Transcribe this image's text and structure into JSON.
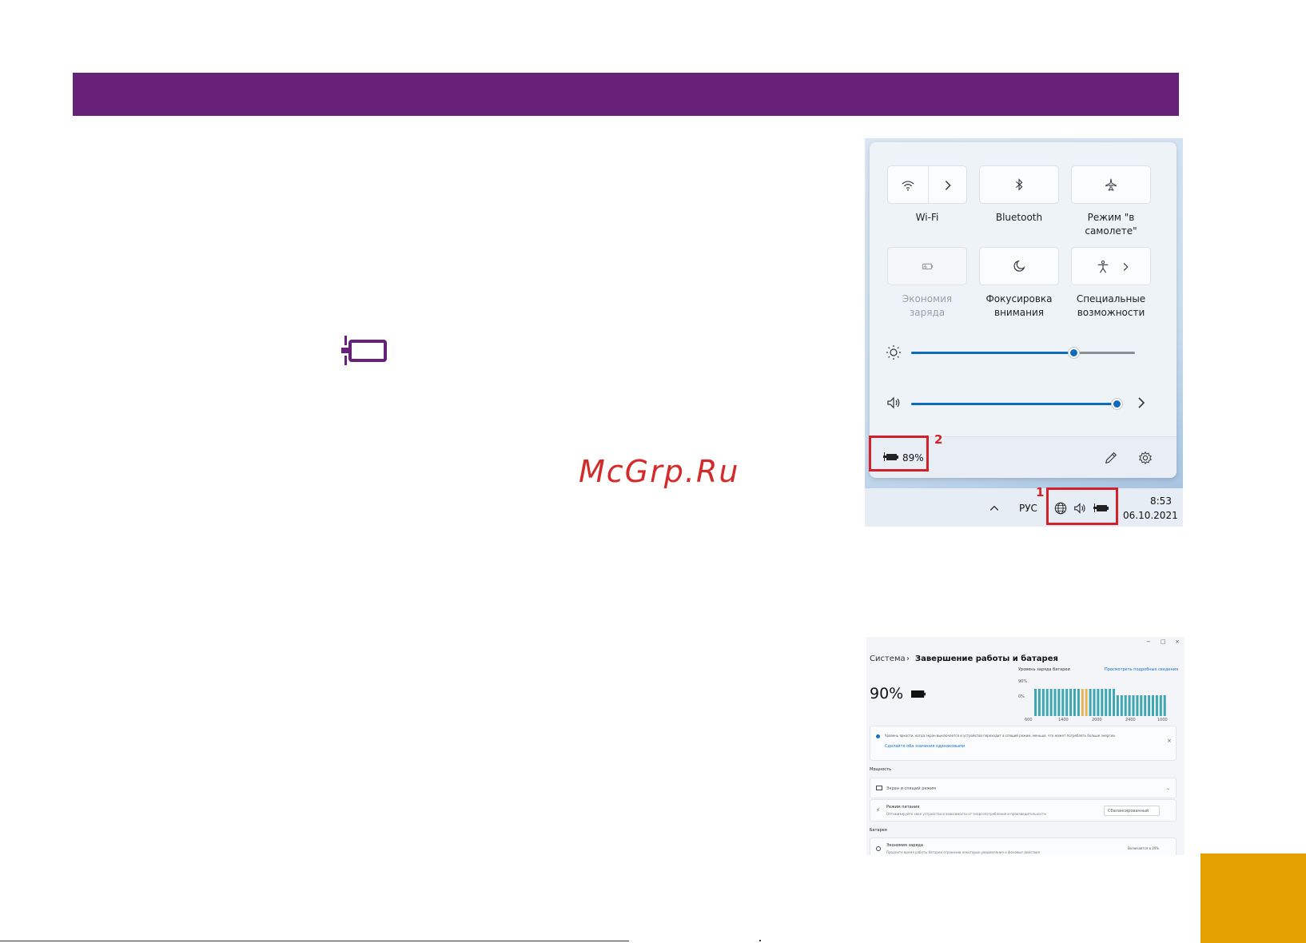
{
  "watermark": "McGrp.Ru",
  "quick_settings": {
    "tiles": [
      {
        "label": "Wi-Fi",
        "icon": "wifi-icon"
      },
      {
        "label": "Bluetooth",
        "icon": "bluetooth-icon"
      },
      {
        "label": "Режим \"в самолете\"",
        "icon": "airplane-icon"
      },
      {
        "label": "Экономия заряда",
        "icon": "battery-saver-icon"
      },
      {
        "label": "Фокусировка внимания",
        "icon": "moon-icon"
      },
      {
        "label": "Специальные возможности",
        "icon": "accessibility-icon"
      }
    ],
    "brightness_level": 0.73,
    "volume_level": 1.0,
    "battery_percent": "89%",
    "callout_1": "1",
    "callout_2": "2",
    "taskbar": {
      "language": "РУС",
      "time": "8:53",
      "date": "06.10.2021"
    }
  },
  "settings_window": {
    "breadcrumb_root": "Система",
    "breadcrumb_page": "Завершение работы и батарея",
    "battery_percent": "90%",
    "chart_title": "Уровень заряда батареи",
    "chart_link": "Просмотреть подробные сведения",
    "y_ticks": [
      "90%",
      "0%"
    ],
    "x_ticks": [
      "600",
      "1400",
      "2000",
      "2400",
      "1000"
    ],
    "info_text": "Уровень яркости, когда экран выключается и устройство переходит в спящий режим, меньше, что может потреблять больше энергии.",
    "info_link": "Сделайте оба значения одинаковыми",
    "section_power": "Мощность",
    "row_screen_sleep": "Экран и спящий режим",
    "row_power_mode": "Режим питания",
    "row_power_mode_desc": "Оптимизируйте свое устройство в зависимости от энергопотребления и производительности",
    "power_mode_value": "Сбалансированный",
    "section_battery": "Батарея",
    "row_battery_saver": "Экономия заряда",
    "row_battery_saver_desc": "Продлите время работы батареи ограничив некоторые уведомления и фоновые действия",
    "battery_saver_value": "Включается в 20%",
    "window_controls": [
      "−",
      "□",
      "×"
    ]
  }
}
